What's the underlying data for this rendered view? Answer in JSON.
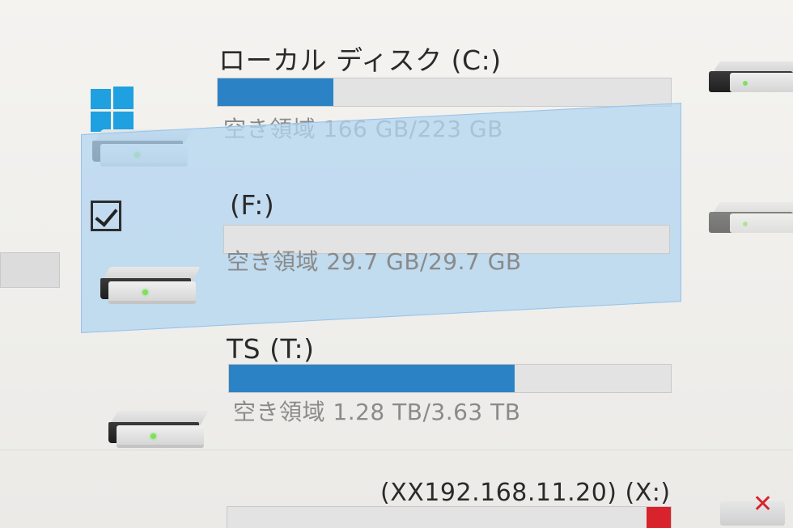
{
  "drives": [
    {
      "name": "ローカル ディスク (C:)",
      "free_text": "空き領域 166 GB/223 GB",
      "used_fraction": 0.256,
      "icon": "windows-hdd-icon",
      "selected": false
    },
    {
      "name": "(F:)",
      "free_text": "空き領域 29.7 GB/29.7 GB",
      "used_fraction": 0.0,
      "icon": "hdd-icon",
      "selected": true
    },
    {
      "name": "TS (T:)",
      "free_text": "空き領域 1.28 TB/3.63 TB",
      "used_fraction": 0.647,
      "icon": "hdd-icon",
      "selected": false
    }
  ],
  "network_drive": {
    "name": "(XX192.168.11.20) (X:)",
    "icon": "network-drive-disconnected-icon"
  },
  "colors": {
    "bar_fill": "#2b83c6",
    "selection": "#b2d4f0",
    "network_error": "#d8222c"
  }
}
